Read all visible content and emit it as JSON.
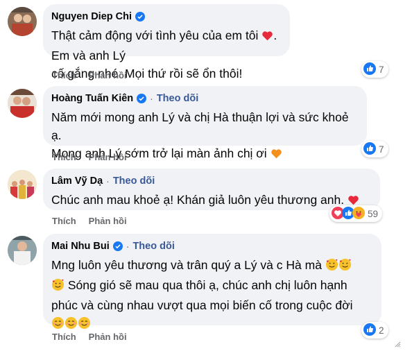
{
  "comments": [
    {
      "name": "Nguyen Diep Chi",
      "show_follow": false,
      "lines": [
        "Thật cảm động với tình yêu của em tôi",
        "cố gắng nhé. Mọi thứ rồi sẽ ổn thôi!"
      ],
      "line1_tail": ". Em và anh Lý",
      "like_label": "Thích",
      "reply_label": "Phản hồi",
      "reaction_count": "7",
      "reactions": [
        "like-icon"
      ]
    },
    {
      "name": "Hoàng Tuấn Kiên",
      "show_follow": true,
      "follow_label": "Theo dõi",
      "lines": [
        "Năm mới mong anh Lý và chị Hà thuận lợi và sức khoẻ ạ.",
        "Mong anh Lý sớm trở lại màn ảnh chị ơi"
      ],
      "like_label": "Thích",
      "reply_label": "Phản hồi",
      "reaction_count": "7",
      "reactions": [
        "like-icon"
      ]
    },
    {
      "name": "Lâm Vỹ Dạ",
      "show_follow": true,
      "follow_label": "Theo dõi",
      "lines": [
        "Chúc anh mau khoẻ ạ! Khán giả luôn yêu thương anh."
      ],
      "like_label": "Thích",
      "reply_label": "Phản hồi",
      "reaction_count": "59",
      "reactions": [
        "love-icon",
        "like-icon",
        "care-icon"
      ]
    },
    {
      "name": "Mai Nhu Bui",
      "show_follow": true,
      "follow_label": "Theo dõi",
      "lines": [
        "Mng luôn yêu thương và trân quý a Lý và c Hà mà",
        "Sóng gió sẽ mau qua thôi ạ, chúc anh chị luôn hạnh",
        "phúc và cùng nhau vượt qua mọi biến cố trong cuộc đời"
      ],
      "like_label": "Thích",
      "reply_label": "Phản hồi",
      "reaction_count": "2",
      "reactions": [
        "like-icon"
      ]
    }
  ],
  "colors": {
    "bubble": "#f0f2f5",
    "verified": "#1877f2",
    "follow": "#385898",
    "action_text": "#65676b"
  }
}
